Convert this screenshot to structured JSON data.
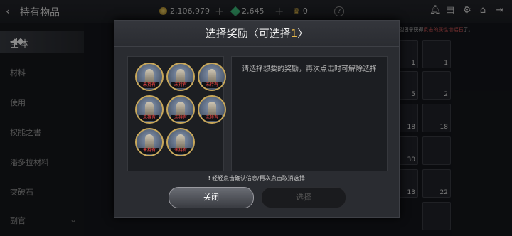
{
  "header": {
    "back_icon": "chevron-left-icon",
    "title": "持有物品"
  },
  "currencies": [
    {
      "icon": "gold-coin-icon",
      "value": "2,106,979"
    },
    {
      "icon": "green-gem-icon",
      "value": "2,645"
    },
    {
      "icon": "crown-icon",
      "value": "0"
    }
  ],
  "header_icons": [
    "bell-icon",
    "chat-icon",
    "gear-icon",
    "home-icon",
    "exit-icon"
  ],
  "sidebar": {
    "selected": "全体",
    "items": [
      "材料",
      "使用",
      "权能之書",
      "潘多拉材料",
      "突破石",
      "副官"
    ]
  },
  "notice": {
    "prefix": "김민종获得",
    "highlight": "反击的属性增幅石",
    "suffix": "了。"
  },
  "grid_counts": [
    "1",
    "1",
    "5",
    "2",
    "18",
    "18",
    "30",
    "",
    "13",
    "22"
  ],
  "modal": {
    "title_prefix": "选择奖励〈可选择",
    "title_count": "1",
    "title_suffix": "〉",
    "description": "请选择想要的奖励，再次点击时可解除选择",
    "portraits": [
      {
        "tag": "未持有"
      },
      {
        "tag": "未持有"
      },
      {
        "tag": "未持有"
      },
      {
        "tag": "未持有"
      },
      {
        "tag": "未持有"
      },
      {
        "tag": "未持有"
      },
      {
        "tag": "未持有"
      },
      {
        "tag": "未持有"
      }
    ],
    "hint": "轻轻点击确认信息/再次点击取消选择",
    "close_label": "关闭",
    "select_label": "选择"
  }
}
